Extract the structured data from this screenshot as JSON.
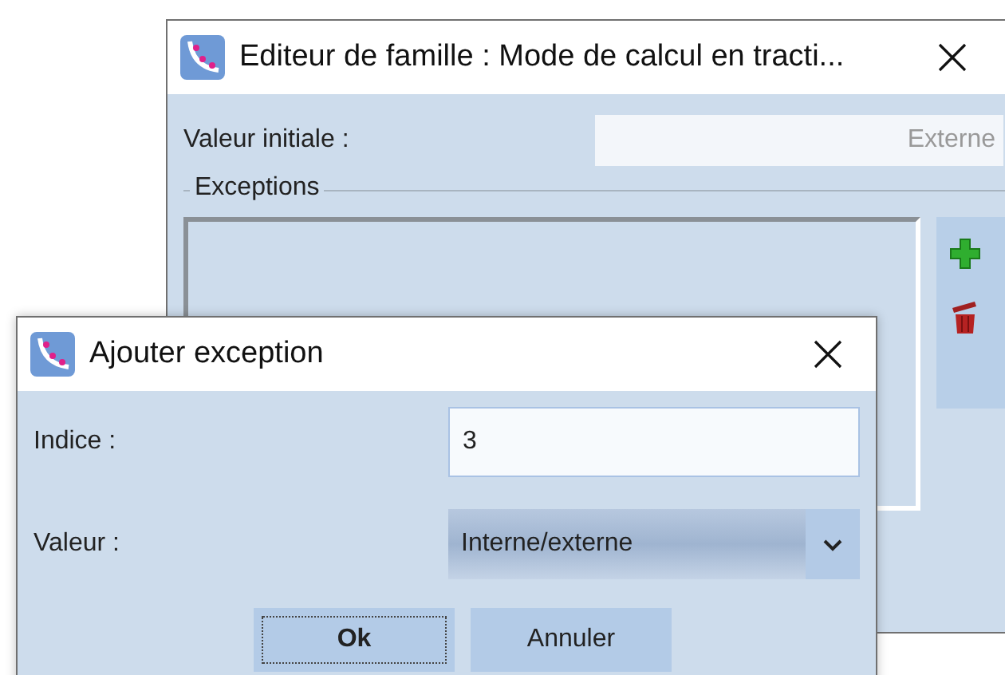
{
  "editor_window": {
    "title": "Editeur de famille : Mode de calcul en tracti...",
    "initial_value": {
      "label": "Valeur initiale :",
      "value": "Externe"
    },
    "exceptions": {
      "label": "Exceptions"
    }
  },
  "dialog": {
    "title": "Ajouter exception",
    "index": {
      "label": "Indice :",
      "value": "3"
    },
    "value": {
      "label": "Valeur :",
      "value": "Interne/externe"
    },
    "buttons": [
      {
        "label": "Ok",
        "focused": true
      },
      {
        "label": "Annuler",
        "focused": false
      }
    ]
  }
}
